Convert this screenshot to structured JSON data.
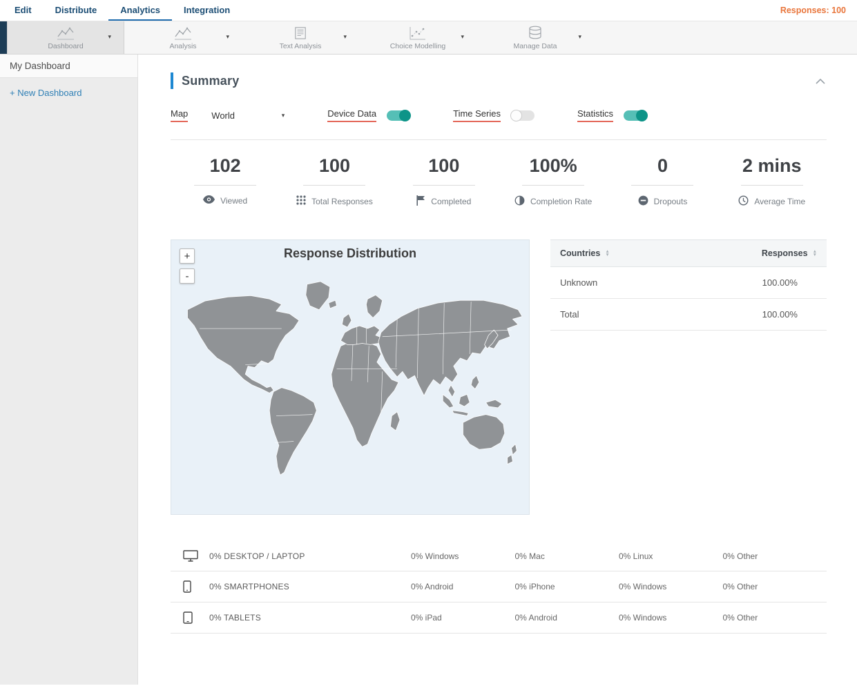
{
  "topnav": {
    "items": [
      {
        "label": "Edit"
      },
      {
        "label": "Distribute"
      },
      {
        "label": "Analytics"
      },
      {
        "label": "Integration"
      }
    ],
    "responses_label": "Responses: 100"
  },
  "toolbar": {
    "items": [
      {
        "label": "Dashboard",
        "icon": "line-chart-icon"
      },
      {
        "label": "Analysis",
        "icon": "line-chart-icon"
      },
      {
        "label": "Text Analysis",
        "icon": "document-icon"
      },
      {
        "label": "Choice Modelling",
        "icon": "scatter-chart-icon"
      },
      {
        "label": "Manage Data",
        "icon": "database-icon"
      }
    ]
  },
  "sidebar": {
    "items": [
      {
        "label": "My Dashboard"
      }
    ],
    "new_dashboard_label": "+ New Dashboard"
  },
  "summary": {
    "title": "Summary",
    "controls": {
      "map_label": "Map",
      "map_value": "World",
      "device_data_label": "Device Data",
      "device_data_on": true,
      "time_series_label": "Time Series",
      "time_series_on": false,
      "statistics_label": "Statistics",
      "statistics_on": true
    },
    "stats": [
      {
        "value": "102",
        "label": "Viewed",
        "icon": "eye-icon"
      },
      {
        "value": "100",
        "label": "Total Responses",
        "icon": "grid-dots-icon"
      },
      {
        "value": "100",
        "label": "Completed",
        "icon": "flag-icon"
      },
      {
        "value": "100%",
        "label": "Completion Rate",
        "icon": "half-circle-icon"
      },
      {
        "value": "0",
        "label": "Dropouts",
        "icon": "minus-circle-icon"
      },
      {
        "value": "2 mins",
        "label": "Average Time",
        "icon": "clock-icon"
      }
    ],
    "map": {
      "title": "Response Distribution",
      "zoom_in_label": "+",
      "zoom_out_label": "-"
    },
    "countries_table": {
      "country_header": "Countries",
      "responses_header": "Responses",
      "rows": [
        {
          "country": "Unknown",
          "responses": "100.00%"
        },
        {
          "country": "Total",
          "responses": "100.00%"
        }
      ]
    },
    "device_table": {
      "rows": [
        {
          "icon": "desktop-icon",
          "category": "0% DESKTOP / LAPTOP",
          "cols": [
            "0% Windows",
            "0% Mac",
            "0% Linux",
            "0% Other"
          ]
        },
        {
          "icon": "smartphone-icon",
          "category": "0% SMARTPHONES",
          "cols": [
            "0% Android",
            "0% iPhone",
            "0% Windows",
            "0% Other"
          ]
        },
        {
          "icon": "tablet-icon",
          "category": "0% TABLETS",
          "cols": [
            "0% iPad",
            "0% Android",
            "0% Windows",
            "0% Other"
          ]
        }
      ]
    }
  },
  "colors": {
    "accent_blue": "#1e88d2",
    "toggle_teal": "#0d9488",
    "highlight_red": "#e4685a",
    "responses_orange": "#e9763c",
    "map_land": "#909396",
    "map_ocean": "#e9f1f8"
  }
}
